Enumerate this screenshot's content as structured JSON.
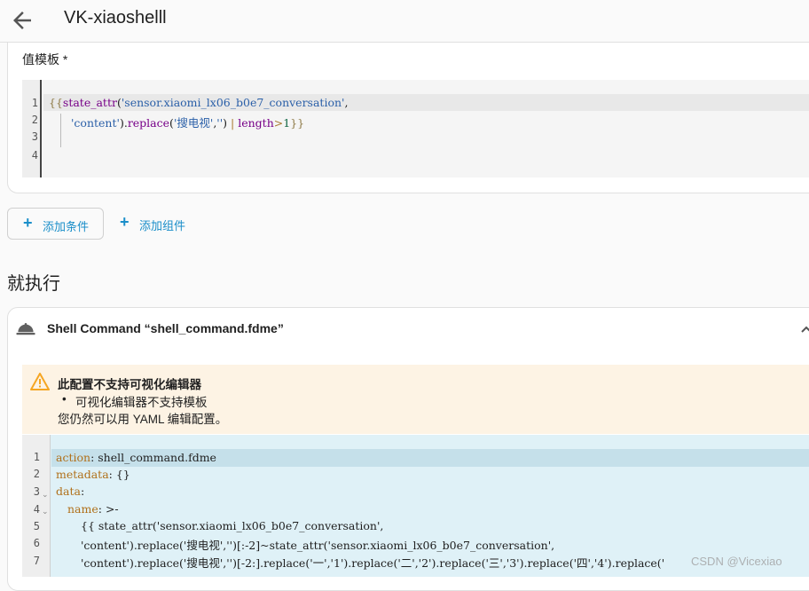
{
  "header": {
    "title": "VK-xiaoshelll",
    "back_icon": "arrow-left-icon"
  },
  "condition": {
    "field_label": "值模板 *",
    "template_lines": {
      "numbers": [
        "1",
        "2",
        "3",
        "4"
      ],
      "l1_open": "{{",
      "l1_fn": "state_attr",
      "l1_paren": "(",
      "l1_str": "'sensor.xiaomi_lx06_b0e7_conversation'",
      "l1_comma": ",",
      "l2_str1": "'content'",
      "l2_mid1": ").",
      "l2_fn": "replace",
      "l2_paren": "(",
      "l2_str2": "'搜电视'",
      "l2_comma": ",",
      "l2_str3": "''",
      "l2_close": ")",
      "l2_pipe": " | ",
      "l2_filter": "length",
      "l2_gt": ">",
      "l2_num": "1",
      "l2_end": "}}"
    }
  },
  "buttons": {
    "add_condition": "添加条件",
    "add_component": "添加组件"
  },
  "then_section": {
    "title": "就执行"
  },
  "action": {
    "title": "Shell Command “shell_command.fdme”",
    "warning": {
      "title": "此配置不支持可视化编辑器",
      "bullet": "可视化编辑器不支持模板",
      "text": "您仍然可以用 YAML 编辑配置。"
    },
    "yaml_lines": {
      "numbers": [
        "1",
        "2",
        "3",
        "4",
        "5",
        "6",
        "7"
      ],
      "l1_key": "action",
      "l1_val": ": shell_command.fdme",
      "l2_key": "metadata",
      "l2_val": ": {}",
      "l3_key": "data",
      "l3_val": ":",
      "l4_key": "name",
      "l4_val": ": >-",
      "l5": "{{ state_attr('sensor.xiaomi_lx06_b0e7_conversation',",
      "l6": "'content').replace('搜电视','')[:-2]~state_attr('sensor.xiaomi_lx06_b0e7_conversation',",
      "l7": "'content').replace('搜电视','')[-2:].replace('一','1').replace('二','2').replace('三','3').replace('四','4').replace('"
    }
  },
  "watermark": "CSDN @Vicexiao",
  "colors": {
    "accent": "#1a8ec9",
    "warning_bg": "#fdf3e4",
    "yaml_bg": "#dff1f7",
    "warning_icon": "#f5a623"
  }
}
